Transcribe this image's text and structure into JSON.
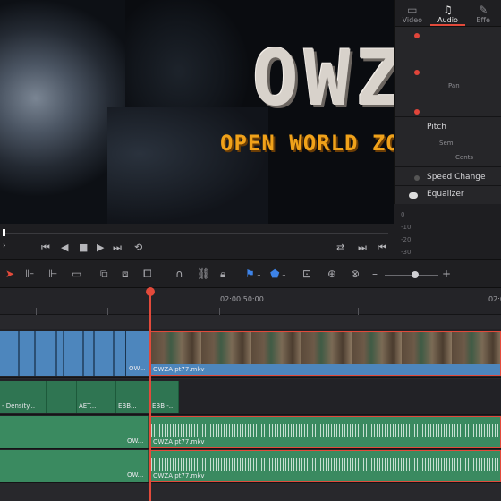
{
  "viewer": {
    "logo_text": "OWZA",
    "subtitle_text": "OPEN WORLD ZOMBIE APOC"
  },
  "inspector": {
    "tabs": [
      {
        "label": "Video",
        "icon": "video-icon",
        "active": false
      },
      {
        "label": "Audio",
        "icon": "music-note-icon",
        "active": true
      },
      {
        "label": "Effe",
        "icon": "effects-icon",
        "active": false
      }
    ],
    "pan_label": "Pan",
    "pitch_label": "Pitch",
    "semi_label": "Semi",
    "cents_label": "Cents",
    "speed_change_label": "Speed Change",
    "equalizer_label": "Equalizer",
    "eq_scale": [
      "0",
      "-10",
      "-20",
      "-30"
    ],
    "accent_color": "#e24a3b"
  },
  "transport": {
    "buttons": [
      "skip-to-start-icon",
      "play-reverse-icon",
      "stop-icon",
      "play-icon",
      "skip-to-end-icon",
      "loop-icon"
    ],
    "right_buttons": [
      "match-frame-icon",
      "prev-marker-icon",
      "next-marker-icon"
    ]
  },
  "toolbar": {
    "zoom_minus": "–",
    "zoom_plus": "+"
  },
  "timeline": {
    "timecodes": [
      "02:00:50:00",
      "02:0"
    ],
    "video_clips": [
      {
        "label": "OW..."
      },
      {
        "label": "OWZA pt77.mkv"
      }
    ],
    "effect_clips": [
      {
        "label": "- Density..."
      },
      {
        "label": "AET..."
      },
      {
        "label": "EBB..."
      },
      {
        "label": "EBB -..."
      }
    ],
    "audio_clips_a1": [
      {
        "label": "OW..."
      },
      {
        "label": "OWZA pt77.mkv"
      }
    ],
    "audio_clips_a2": [
      {
        "label": "OW..."
      },
      {
        "label": "OWZA pt77.mkv"
      }
    ]
  }
}
